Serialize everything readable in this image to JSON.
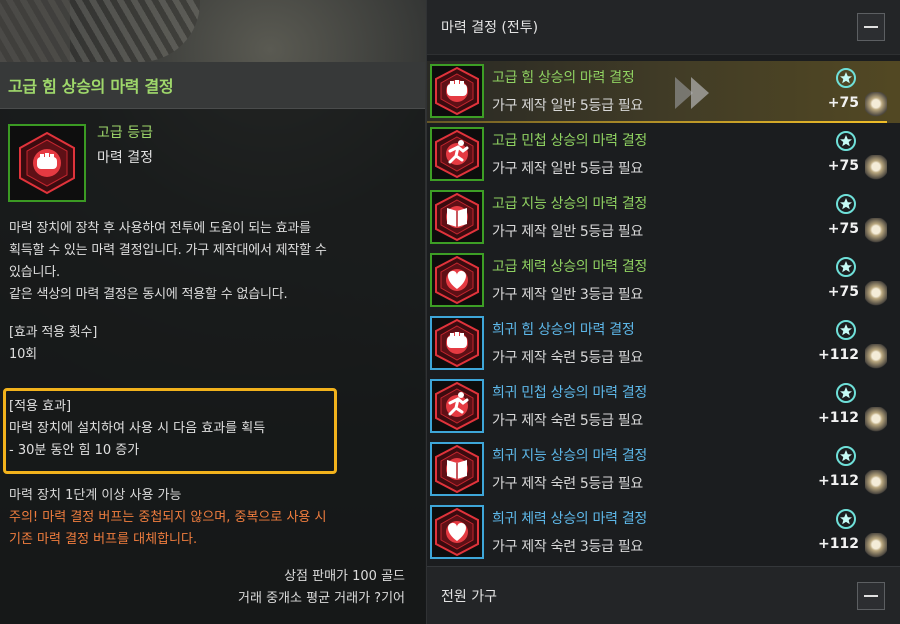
{
  "tooltip": {
    "title": "고급 힘 상승의 마력 결정",
    "grade": "고급 등급",
    "item_type": "마력 결정",
    "description": [
      "마력 장치에 장착 후 사용하여 전투에 도움이 되는 효과를",
      "획득할 수 있는 마력 결정입니다. 가구 제작대에서 제작할 수",
      "있습니다.",
      "같은 색상의 마력 결정은 동시에 적용할 수 없습니다."
    ],
    "apply_count_title": "[효과 적용 횟수]",
    "apply_count_value": "10회",
    "effect_title": "[적용 효과]",
    "effect_lines": [
      "마력 장치에 설치하여 사용 시 다음 효과를 획득",
      "- 30분 동안 힘 10 증가"
    ],
    "requirement": "마력 장치 1단계 이상 사용 가능",
    "warning_lines": [
      "주의! 마력 결정 버프는 중첩되지 않으며, 중복으로 사용 시",
      "기존 마력 결정 버프를 대체합니다."
    ],
    "shop_price": "상점 판매가 100 골드",
    "market_price": "거래 중개소 평균 거래가 ?기어"
  },
  "panel": {
    "section_title": "마력 결정 (전투)",
    "footer_title": "전원 가구",
    "items": [
      {
        "name": "고급 힘 상승의 마력 결정",
        "req": "가구 제작 일반 5등급 필요",
        "count": "+75",
        "tier": "green",
        "icon": "fist-icon"
      },
      {
        "name": "고급 민첩 상승의 마력 결정",
        "req": "가구 제작 일반 5등급 필요",
        "count": "+75",
        "tier": "green",
        "icon": "running-man-icon"
      },
      {
        "name": "고급 지능 상승의 마력 결정",
        "req": "가구 제작 일반 5등급 필요",
        "count": "+75",
        "tier": "green",
        "icon": "book-icon"
      },
      {
        "name": "고급 체력 상승의 마력 결정",
        "req": "가구 제작 일반 3등급 필요",
        "count": "+75",
        "tier": "green",
        "icon": "heart-icon"
      },
      {
        "name": "희귀 힘 상승의 마력 결정",
        "req": "가구 제작 숙련 5등급 필요",
        "count": "+112",
        "tier": "blue",
        "icon": "fist-icon"
      },
      {
        "name": "희귀 민첩 상승의 마력 결정",
        "req": "가구 제작 숙련 5등급 필요",
        "count": "+112",
        "tier": "blue",
        "icon": "running-man-icon"
      },
      {
        "name": "희귀 지능 상승의 마력 결정",
        "req": "가구 제작 숙련 5등급 필요",
        "count": "+112",
        "tier": "blue",
        "icon": "book-icon"
      },
      {
        "name": "희귀 체력 상승의 마력 결정",
        "req": "가구 제작 숙련 3등급 필요",
        "count": "+112",
        "tier": "blue",
        "icon": "heart-icon"
      }
    ]
  },
  "colors": {
    "green_grade": "#8fd161",
    "blue_grade": "#5db7e8",
    "highlight": "#f2b21c",
    "warning": "#f07d3e",
    "crystal_red": "#e0333b"
  }
}
